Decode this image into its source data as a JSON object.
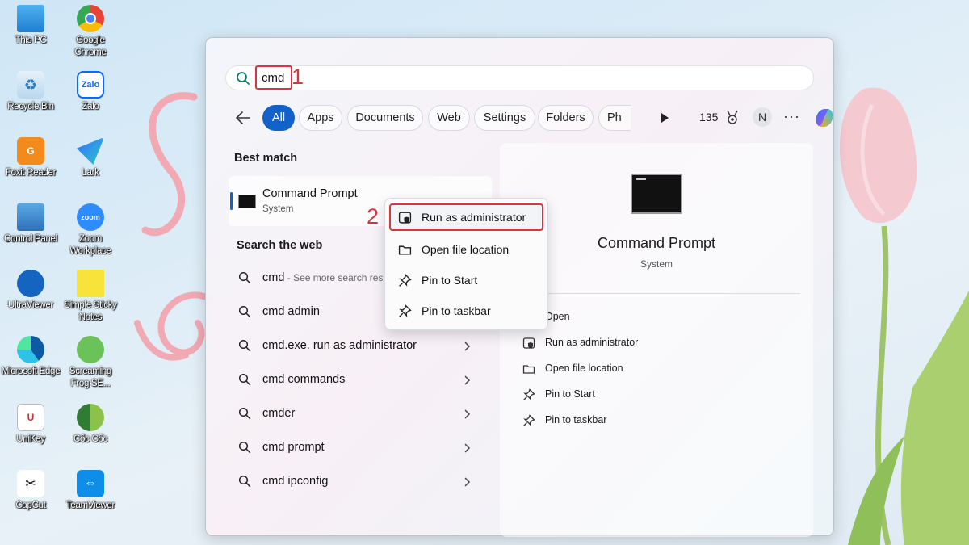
{
  "desktop_icons": [
    {
      "label": "This PC",
      "icon": "this-pc-icon"
    },
    {
      "label": "Google Chrome",
      "icon": "chrome-icon"
    },
    {
      "label": "Recycle Bin",
      "icon": "recycle-bin-icon"
    },
    {
      "label": "Zalo",
      "icon": "zalo-icon"
    },
    {
      "label": "Foxit Reader",
      "icon": "foxit-reader-icon"
    },
    {
      "label": "Lark",
      "icon": "lark-icon"
    },
    {
      "label": "Control Panel",
      "icon": "control-panel-icon"
    },
    {
      "label": "Zoom Workplace",
      "icon": "zoom-icon"
    },
    {
      "label": "UltraViewer",
      "icon": "ultraviewer-icon"
    },
    {
      "label": "Simple Sticky Notes",
      "icon": "sticky-notes-icon"
    },
    {
      "label": "Microsoft Edge",
      "icon": "edge-icon"
    },
    {
      "label": "Screaming Frog SE...",
      "icon": "screaming-frog-icon"
    },
    {
      "label": "UniKey",
      "icon": "unikey-icon"
    },
    {
      "label": "Cốc Cốc",
      "icon": "coc-coc-icon"
    },
    {
      "label": "CapCut",
      "icon": "capcut-icon"
    },
    {
      "label": "TeamViewer",
      "icon": "teamviewer-icon"
    }
  ],
  "search": {
    "query": "cmd",
    "step_1": "1",
    "step_2": "2"
  },
  "filters": {
    "tabs": [
      "All",
      "Apps",
      "Documents",
      "Web",
      "Settings",
      "Folders",
      "Ph"
    ],
    "active": "All",
    "points": "135",
    "avatar_initial": "N",
    "more": "···"
  },
  "results": {
    "best_match_title": "Best match",
    "best_match": {
      "name": "Command Prompt",
      "type": "System"
    },
    "web_title": "Search the web",
    "web_items": [
      {
        "query": "cmd",
        "hint": " - See more search results"
      },
      {
        "query": "cmd admin",
        "hint": ""
      },
      {
        "query": "cmd.exe. run as administrator",
        "hint": ""
      },
      {
        "query": "cmd commands",
        "hint": ""
      },
      {
        "query": "cmder",
        "hint": ""
      },
      {
        "query": "cmd prompt",
        "hint": ""
      },
      {
        "query": "cmd ipconfig",
        "hint": ""
      }
    ]
  },
  "context_menu": {
    "items": [
      "Run as administrator",
      "Open file location",
      "Pin to Start",
      "Pin to taskbar"
    ]
  },
  "preview": {
    "title": "Command Prompt",
    "subtitle": "System",
    "actions": [
      "Open",
      "Run as administrator",
      "Open file location",
      "Pin to Start",
      "Pin to taskbar"
    ]
  },
  "colors": {
    "accent": "#1262c9",
    "highlight": "#d9343f"
  }
}
